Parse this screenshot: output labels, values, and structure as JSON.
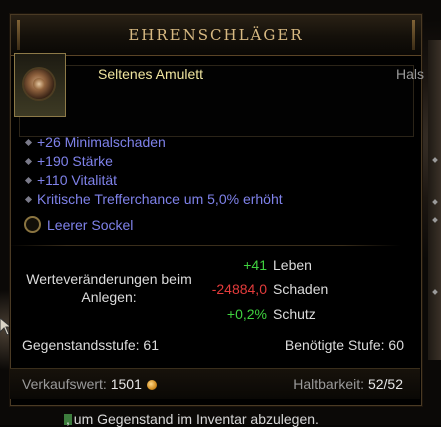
{
  "tooltip": {
    "title": "EHRENSCHLÄGER",
    "item_type": "Seltenes Amulett",
    "slot": "Hals",
    "icon": "amulet-icon"
  },
  "stats": [
    "+26 Minimalschaden",
    "+190 Stärke",
    "+110 Vitalität",
    "Kritische Trefferchance um 5,0% erhöht"
  ],
  "socket": {
    "label": "Leerer Sockel",
    "icon": "socket-icon"
  },
  "comparison": {
    "label": "Werteveränderungen beim Anlegen:",
    "rows": [
      {
        "value": "+41",
        "name": "Leben",
        "color": "#3fd23f"
      },
      {
        "value": "-24884,0",
        "name": "Schaden",
        "color": "#e33b3b"
      },
      {
        "value": "+0,2%",
        "name": "Schutz",
        "color": "#3fd23f"
      }
    ]
  },
  "requirements": {
    "item_level": "Gegenstandsstufe: 61",
    "required_level": "Benötigte Stufe: 60"
  },
  "footer": {
    "sell_label": "Verkaufswert:",
    "sell_value": "1501",
    "durability_label": "Haltbarkeit:",
    "durability_value": "52/52",
    "coin_icon": "gold-coin-icon"
  },
  "hint": ", um Gegenstand im Inventar abzulegen.",
  "colors": {
    "magic_blue": "#7f82ea",
    "rare_yellow": "#f1e6a0",
    "title_gold": "#d7b982",
    "positive": "#3fd23f",
    "negative": "#e33b3b"
  }
}
